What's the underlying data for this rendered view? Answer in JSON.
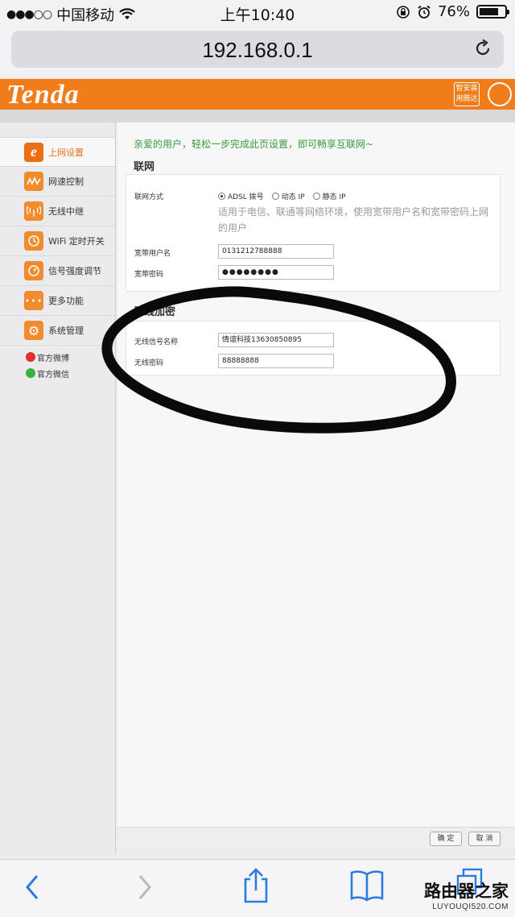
{
  "status_bar": {
    "carrier": "中国移动",
    "time": "上午10:40",
    "battery": "76%",
    "battery_level": 0.76
  },
  "browser": {
    "url": "192.168.0.1"
  },
  "header": {
    "logo": "Tenda",
    "badge_text": "智安装 用腾达",
    "colors": {
      "brand": "#f07d1a"
    }
  },
  "sidebar": {
    "items": [
      {
        "label": "上网设置",
        "icon": "e",
        "active": true
      },
      {
        "label": "网速控制",
        "icon": "speed"
      },
      {
        "label": "无线中继",
        "icon": "relay"
      },
      {
        "label": "WiFi 定时开关",
        "icon": "clock"
      },
      {
        "label": "信号强度调节",
        "icon": "signal"
      },
      {
        "label": "更多功能",
        "icon": "more"
      },
      {
        "label": "系统管理",
        "icon": "gear"
      }
    ],
    "social": [
      {
        "label": "官方微博",
        "color": "#e0302a"
      },
      {
        "label": "官方微信",
        "color": "#3bb13b"
      }
    ]
  },
  "main": {
    "greeting": "亲爱的用户，轻松一步完成此页设置，即可畅享互联网~",
    "internet": {
      "title": "联网",
      "mode_label": "联网方式",
      "modes": [
        "ADSL 拨号",
        "动态 IP",
        "静态 IP"
      ],
      "selected_mode": "ADSL 拨号",
      "hint": "适用于电信、联通等网络环境，使用宽带用户名和宽带密码上网的用户",
      "username_label": "宽带用户名",
      "username_value": "0131212788888",
      "password_label": "宽带密码",
      "password_value": "●●●●●●●●"
    },
    "wireless": {
      "title": "无线加密",
      "ssid_label": "无线信号名称",
      "ssid_value": "情谊科技13630850895",
      "key_label": "无线密码",
      "key_value": "88888888"
    },
    "buttons": {
      "ok": "确 定",
      "cancel": "取 消"
    }
  },
  "watermark": {
    "main": "路由器之家",
    "sub": "LUYOUQI520.COM"
  }
}
